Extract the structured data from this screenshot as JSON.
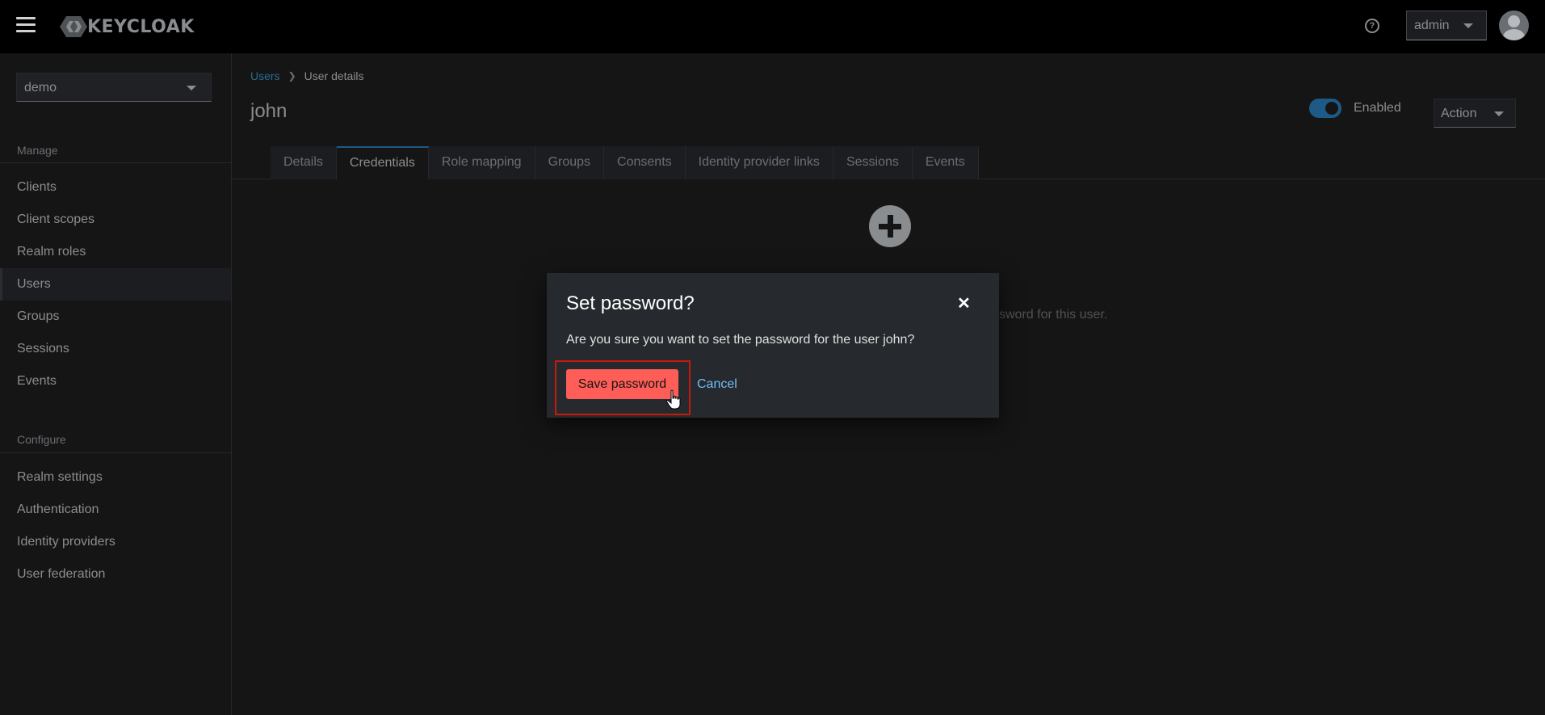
{
  "header": {
    "logo_text": "KEYCLOAK",
    "user_label": "admin"
  },
  "sidebar": {
    "realm": "demo",
    "manage_heading": "Manage",
    "manage_items": [
      "Clients",
      "Client scopes",
      "Realm roles",
      "Users",
      "Groups",
      "Sessions",
      "Events"
    ],
    "active_item": "Users",
    "configure_heading": "Configure",
    "configure_items": [
      "Realm settings",
      "Authentication",
      "Identity providers",
      "User federation"
    ]
  },
  "page": {
    "breadcrumb": {
      "parent": "Users",
      "current": "User details"
    },
    "title": "john",
    "enabled_label": "Enabled",
    "enabled": true,
    "action_label": "Action",
    "tabs": [
      "Details",
      "Credentials",
      "Role mapping",
      "Groups",
      "Consents",
      "Identity provider links",
      "Sessions",
      "Events"
    ],
    "active_tab": "Credentials",
    "empty_text_visible": "sword for this user."
  },
  "modal": {
    "title": "Set password?",
    "body": "Are you sure you want to set the password for the user john?",
    "confirm_label": "Save password",
    "cancel_label": "Cancel"
  },
  "colors": {
    "accent": "#1d5a87",
    "danger_button": "#fe5e57",
    "link": "#73bcf7",
    "highlight": "#c9190b"
  }
}
